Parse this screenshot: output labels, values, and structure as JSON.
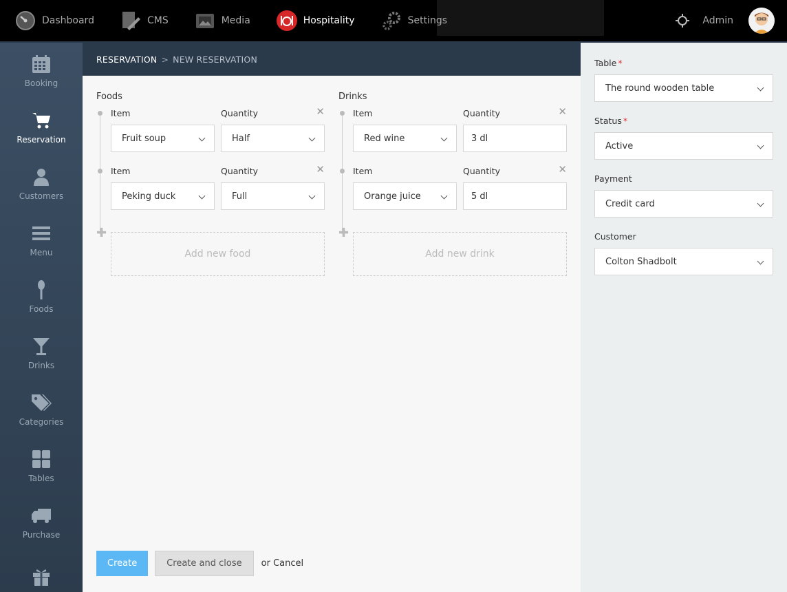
{
  "topnav": {
    "items": [
      {
        "label": "Dashboard",
        "icon": "speedometer-icon"
      },
      {
        "label": "CMS",
        "icon": "cms-icon"
      },
      {
        "label": "Media",
        "icon": "media-icon"
      },
      {
        "label": "Hospitality",
        "icon": "hospitality-icon",
        "active": true
      },
      {
        "label": "Settings",
        "icon": "gears-icon"
      }
    ],
    "user_label": "Admin"
  },
  "sidebar": {
    "items": [
      {
        "label": "Booking",
        "icon": "calendar-icon"
      },
      {
        "label": "Reservation",
        "icon": "cart-icon",
        "active": true
      },
      {
        "label": "Customers",
        "icon": "person-icon"
      },
      {
        "label": "Menu",
        "icon": "menu-icon"
      },
      {
        "label": "Foods",
        "icon": "spoon-icon"
      },
      {
        "label": "Drinks",
        "icon": "cocktail-icon"
      },
      {
        "label": "Categories",
        "icon": "tags-icon"
      },
      {
        "label": "Tables",
        "icon": "grid-icon"
      },
      {
        "label": "Purchase",
        "icon": "truck-icon"
      },
      {
        "label": "",
        "icon": "gift-icon"
      }
    ]
  },
  "breadcrumb": {
    "parent": "RESERVATION",
    "separator": ">",
    "current": "NEW RESERVATION"
  },
  "foods": {
    "title": "Foods",
    "item_label": "Item",
    "quantity_label": "Quantity",
    "rows": [
      {
        "item": "Fruit soup",
        "quantity": "Half"
      },
      {
        "item": "Peking duck",
        "quantity": "Full"
      }
    ],
    "add_label": "Add new food"
  },
  "drinks": {
    "title": "Drinks",
    "item_label": "Item",
    "quantity_label": "Quantity",
    "rows": [
      {
        "item": "Red wine",
        "quantity": "3 dl"
      },
      {
        "item": "Orange juice",
        "quantity": "5 dl"
      }
    ],
    "add_label": "Add new drink"
  },
  "actions": {
    "create": "Create",
    "create_close": "Create and close",
    "or": "or",
    "cancel": "Cancel"
  },
  "right": {
    "table": {
      "label": "Table",
      "value": "The round wooden table"
    },
    "status": {
      "label": "Status",
      "value": "Active"
    },
    "payment": {
      "label": "Payment",
      "value": "Credit card"
    },
    "customer": {
      "label": "Customer",
      "value": "Colton Shadbolt"
    },
    "required_mark": "*"
  },
  "colors": {
    "accent": "#5bb8f5",
    "topbar": "#000000",
    "sidebar": "#34475a",
    "hospitality_icon": "#d62828"
  }
}
